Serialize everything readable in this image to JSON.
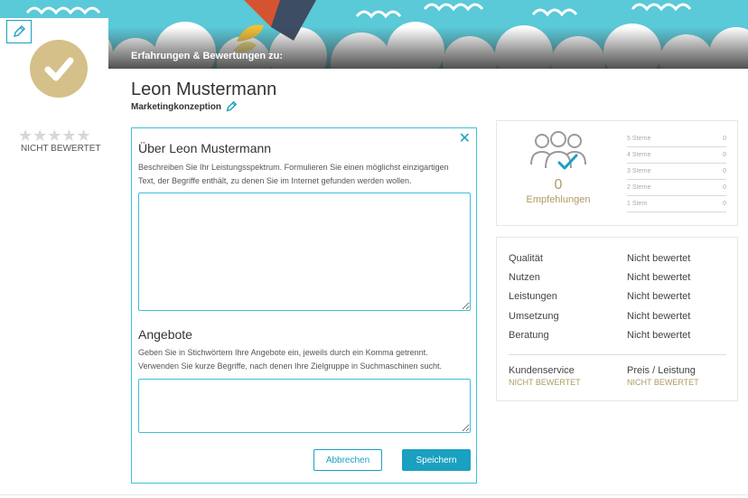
{
  "header": {
    "banner_title": "Erfahrungen & Bewertungen zu:"
  },
  "profile": {
    "name": "Leon Mustermann",
    "subtitle": "Marketingkonzeption",
    "rating_label": "NICHT BEWERTET",
    "stars": "★★★★★"
  },
  "modal": {
    "close_label": "✕",
    "about_title": "Über Leon Mustermann",
    "about_desc": "Beschreiben Sie Ihr Leistungsspektrum. Formulieren Sie einen möglichst einzigartigen Text, der Begriffe enthält, zu denen Sie im Internet gefunden werden wollen.",
    "about_value": "",
    "offers_title": "Angebote",
    "offers_desc": "Geben Sie in Stichwörtern Ihre Angebote ein, jeweils durch ein Komma getrennt. Verwenden Sie kurze Begriffe, nach denen Ihre Zielgruppe in Suchmaschinen sucht.",
    "offers_value": "",
    "cancel_label": "Abbrechen",
    "save_label": "Speichern"
  },
  "recommendations": {
    "count": "0",
    "label": "Empfehlungen",
    "distribution": [
      {
        "label": "5 Sterne",
        "value": "0"
      },
      {
        "label": "4 Sterne",
        "value": "0"
      },
      {
        "label": "3 Sterne",
        "value": "0"
      },
      {
        "label": "2 Sterne",
        "value": "0"
      },
      {
        "label": "1 Stern",
        "value": "0"
      }
    ]
  },
  "ratings": {
    "rows": [
      {
        "label": "Qualität",
        "value": "Nicht bewertet"
      },
      {
        "label": "Nutzen",
        "value": "Nicht bewertet"
      },
      {
        "label": "Leistungen",
        "value": "Nicht bewertet"
      },
      {
        "label": "Umsetzung",
        "value": "Nicht bewertet"
      },
      {
        "label": "Beratung",
        "value": "Nicht bewertet"
      }
    ],
    "extra": [
      {
        "label": "Kundenservice",
        "value": "NICHT BEWERTET"
      },
      {
        "label": "Preis / Leistung",
        "value": "NICHT BEWERTET"
      }
    ]
  },
  "colors": {
    "accent": "#1aa0c0",
    "gold": "#b09a63",
    "sky": "#5ac9d8"
  }
}
